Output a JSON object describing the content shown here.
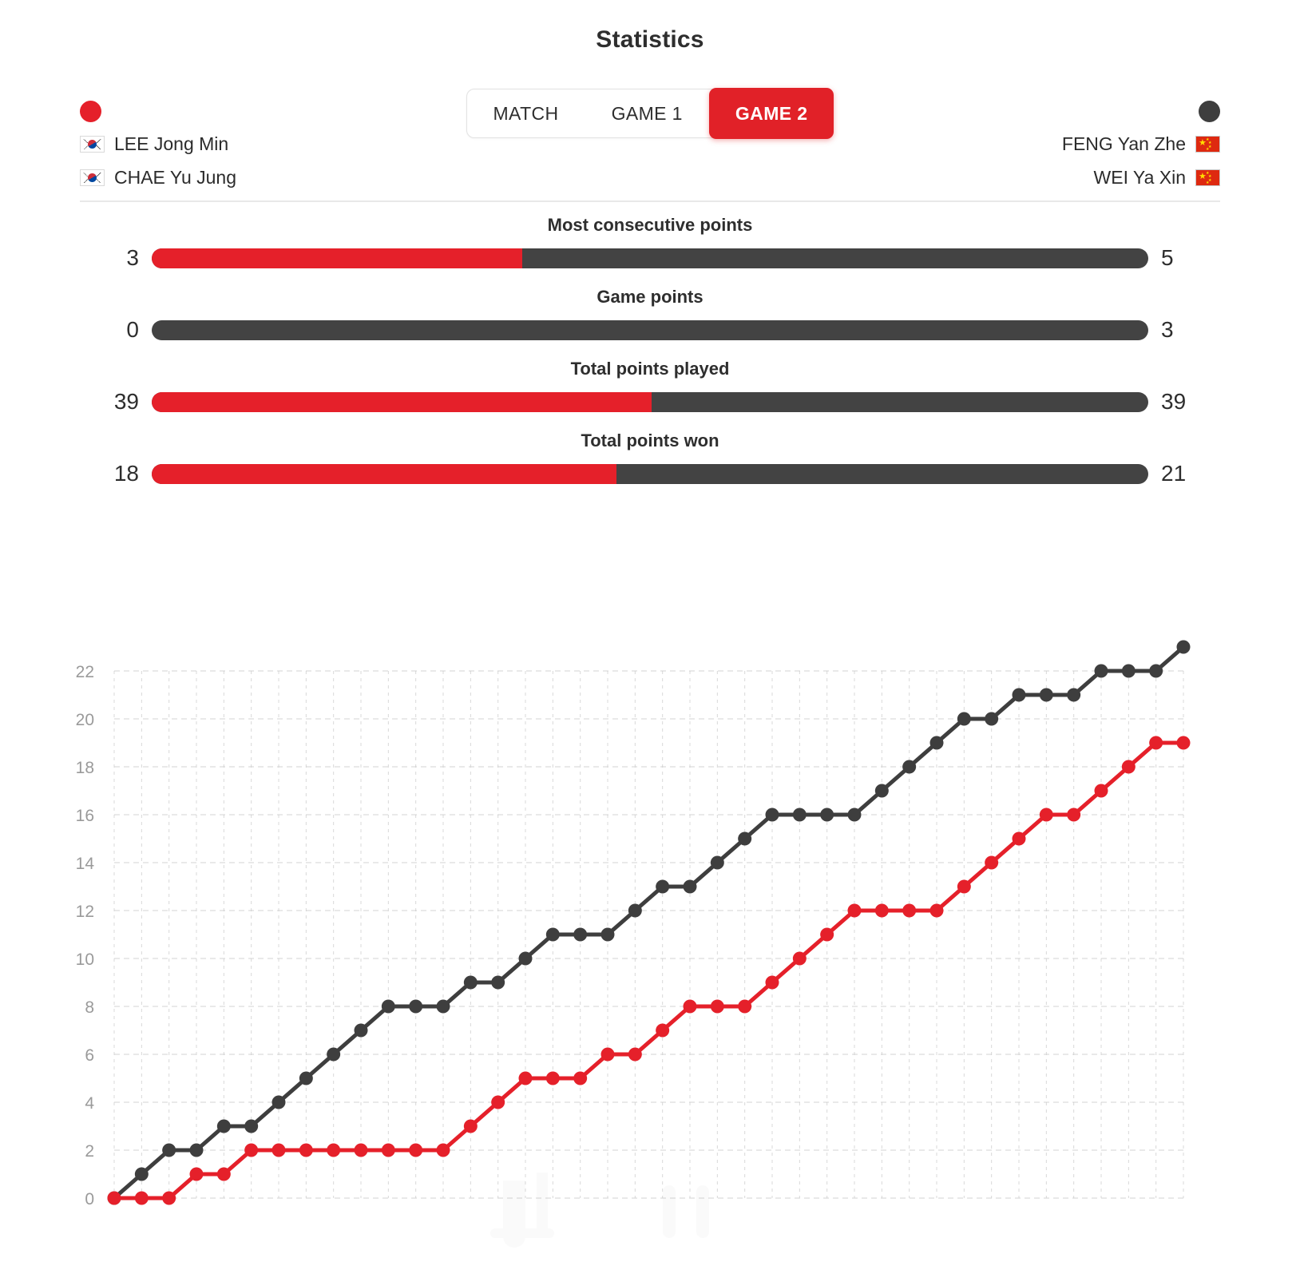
{
  "header": {
    "title": "Statistics"
  },
  "tabs": [
    {
      "label": "MATCH",
      "active": false
    },
    {
      "label": "GAME 1",
      "active": false
    },
    {
      "label": "GAME 2",
      "active": true
    }
  ],
  "colors": {
    "red": "#e5202a",
    "dark": "#434343",
    "tab_active_bg": "#e12128",
    "grid": "#cccccc",
    "text": "#2e2e2e"
  },
  "teams": {
    "left": {
      "marker": "red-dot",
      "color": "#e5202a",
      "country": "KR",
      "players": [
        "LEE Jong Min",
        "CHAE Yu Jung"
      ]
    },
    "right": {
      "marker": "dark-dot",
      "color": "#3e3e3e",
      "country": "CN",
      "players": [
        "FENG Yan Zhe",
        "WEI Ya Xin"
      ]
    }
  },
  "stats": [
    {
      "label": "Most consecutive points",
      "left": "3",
      "right": "5",
      "left_pct": 37.2
    },
    {
      "label": "Game points",
      "left": "0",
      "right": "3",
      "left_pct": 0
    },
    {
      "label": "Total points played",
      "left": "39",
      "right": "39",
      "left_pct": 50.2
    },
    {
      "label": "Total points won",
      "left": "18",
      "right": "21",
      "left_pct": 46.6
    }
  ],
  "chart_data": {
    "type": "line",
    "title": "",
    "xlabel": "",
    "ylabel": "",
    "ylim": [
      0,
      22
    ],
    "yticks": [
      0,
      2,
      4,
      6,
      8,
      10,
      12,
      14,
      16,
      18,
      20,
      22
    ],
    "grid": true,
    "legend": "none",
    "x": [
      0,
      1,
      2,
      3,
      4,
      5,
      6,
      7,
      8,
      9,
      10,
      11,
      12,
      13,
      14,
      15,
      16,
      17,
      18,
      19,
      20,
      21,
      22,
      23,
      24,
      25,
      26,
      27,
      28,
      29,
      30,
      31,
      32,
      33,
      34,
      35,
      36,
      37,
      38,
      39
    ],
    "series": [
      {
        "name": "FENG Yan Zhe / WEI Ya Xin",
        "color": "#3e3e3e",
        "values": [
          0,
          1,
          2,
          2,
          3,
          3,
          4,
          5,
          6,
          7,
          8,
          8,
          8,
          9,
          9,
          10,
          11,
          11,
          11,
          12,
          13,
          13,
          14,
          15,
          16,
          16,
          16,
          16,
          17,
          18,
          19,
          20,
          20,
          21,
          21,
          21,
          22,
          22,
          22,
          23
        ]
      },
      {
        "name": "LEE Jong Min / CHAE Yu Jung",
        "color": "#e5202a",
        "values": [
          0,
          0,
          0,
          1,
          1,
          2,
          2,
          2,
          2,
          2,
          2,
          2,
          2,
          3,
          4,
          5,
          5,
          5,
          6,
          6,
          7,
          8,
          8,
          8,
          9,
          10,
          11,
          12,
          12,
          12,
          12,
          13,
          14,
          15,
          16,
          16,
          17,
          18,
          19,
          19
        ]
      }
    ],
    "final_scores": {
      "dark": 21,
      "red": 18
    }
  }
}
